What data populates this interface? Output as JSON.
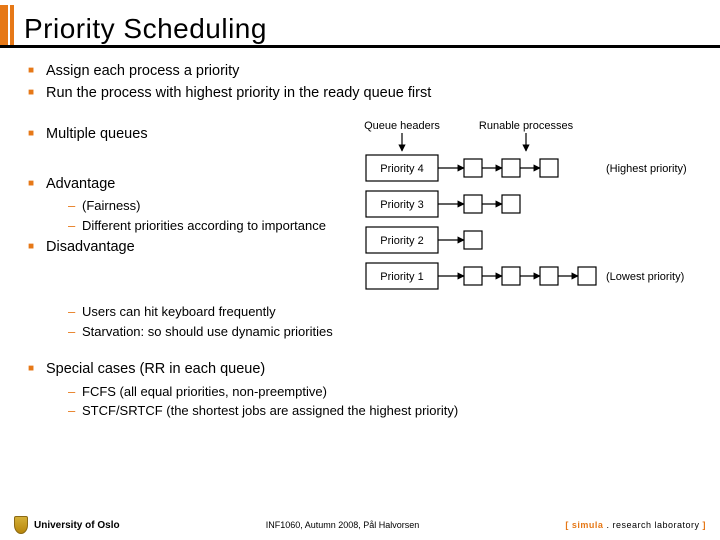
{
  "title": "Priority Scheduling",
  "bullets": {
    "b0": "Assign each process a priority",
    "b1": "Run the process with highest priority in the ready queue first",
    "b2": "Multiple queues",
    "b3": "Advantage",
    "b3a": "(Fairness)",
    "b3b": "Different priorities according to importance",
    "b4": "Disadvantage",
    "b4a": "Users can hit keyboard frequently",
    "b4b": "Starvation: so should use dynamic priorities",
    "b5": "Special cases (RR in each queue)",
    "b5a": "FCFS (all equal priorities, non-preemptive)",
    "b5b": "STCF/SRTCF (the shortest jobs are assigned the highest priority)"
  },
  "diagram": {
    "label_headers": "Queue headers",
    "label_runable": "Runable processes",
    "p4": "Priority 4",
    "p3": "Priority 3",
    "p2": "Priority 2",
    "p1": "Priority 1",
    "hi": "(Highest priority)",
    "lo": "(Lowest priority)"
  },
  "footer": {
    "uni": "University of Oslo",
    "course": "INF1060, Autumn 2008, Pål Halvorsen",
    "lab_open": "[ ",
    "lab_s": "simula",
    "lab_dot": " . ",
    "lab_rest": "research laboratory",
    "lab_close": " ]"
  }
}
